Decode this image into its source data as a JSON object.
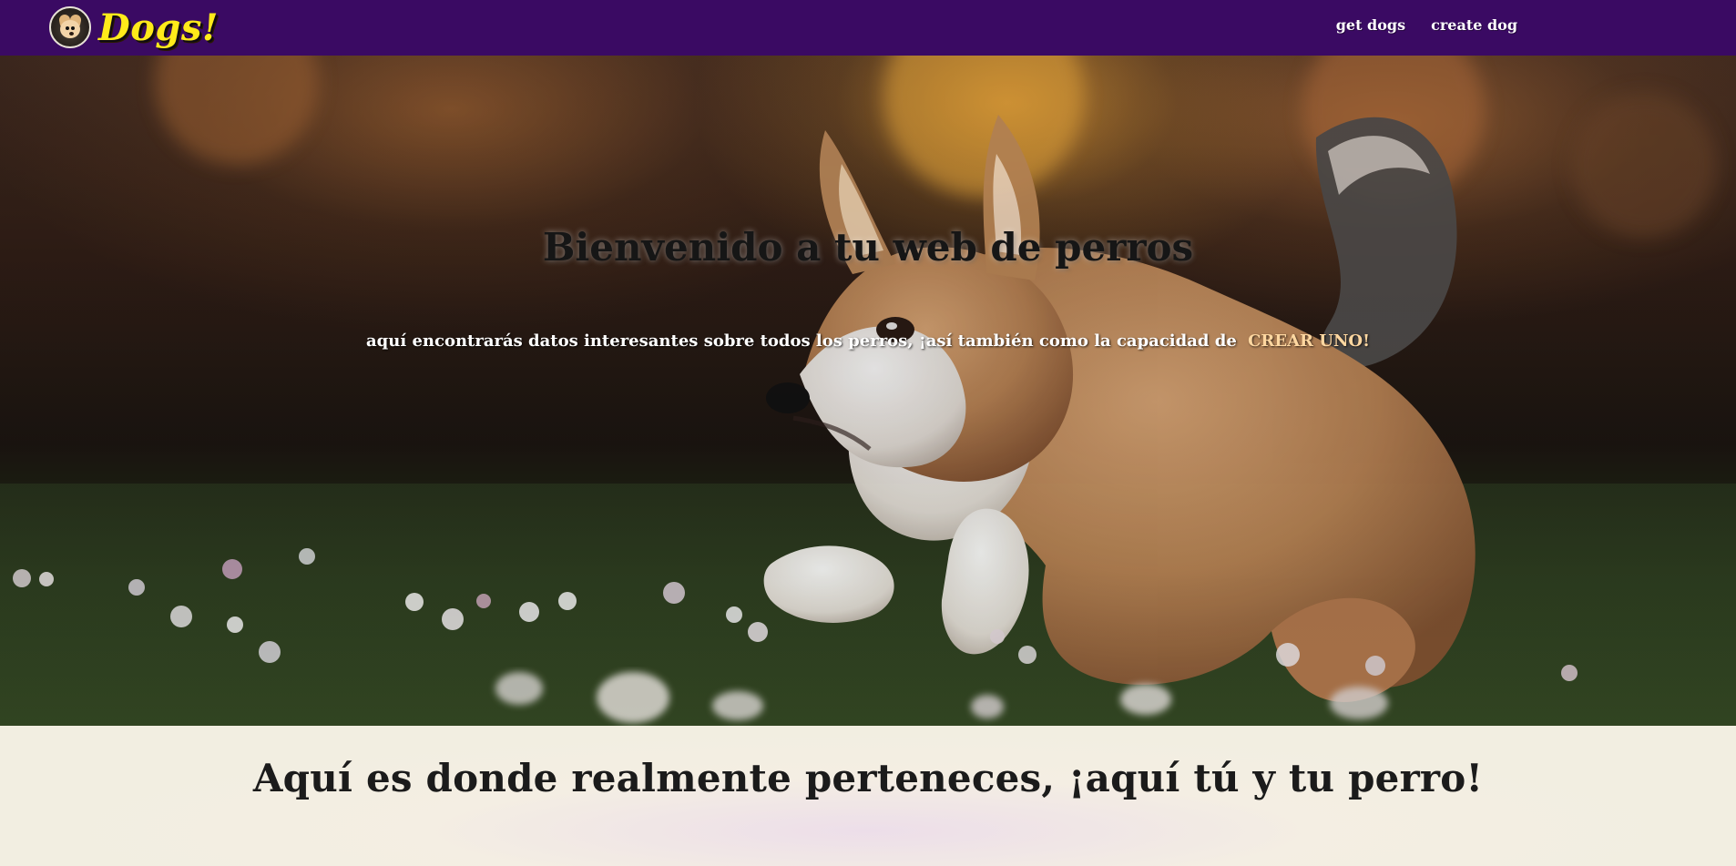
{
  "app": {
    "title": "Dogs!"
  },
  "navbar": {
    "brand_text": "Dogs!",
    "links": [
      {
        "label": "get dogs"
      },
      {
        "label": "create dog"
      }
    ]
  },
  "hero": {
    "title": "Bienvenido a tu web de perros",
    "subtitle": "aquí encontrarás datos interesantes sobre todos los perros, ¡así también como la capacidad de",
    "cta": "CREAR UNO!"
  },
  "bottom": {
    "title": "Aquí es donde realmente perteneces, ¡aquí tú y tu perro!"
  },
  "colors": {
    "navbar": "#3a0a63",
    "brand": "#ffea1a",
    "cta": "#ffd7a0",
    "bottom_background": "#f2eee1"
  },
  "icons": {
    "logo": "dog-face-logo"
  }
}
